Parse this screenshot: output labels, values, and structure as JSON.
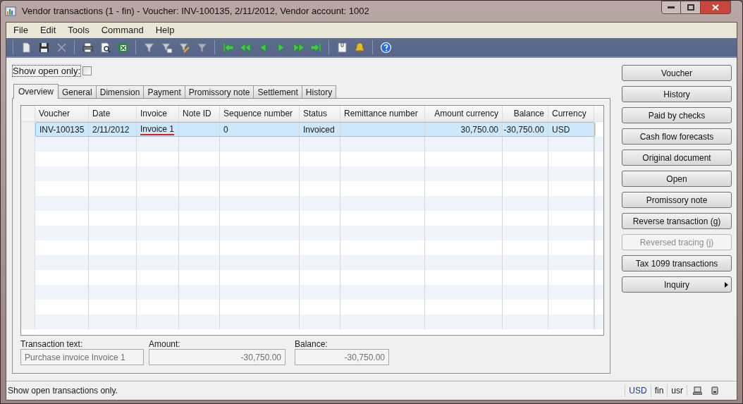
{
  "window": {
    "title": "Vendor transactions (1 - fin) - Voucher: INV-100135, 2/11/2012, Vendor account: 1002"
  },
  "menu": [
    "File",
    "Edit",
    "Tools",
    "Command",
    "Help"
  ],
  "show_open_only": {
    "label": "Show open only:",
    "checked": false
  },
  "tabs": [
    {
      "label": "Overview",
      "selected": true
    },
    {
      "label": "General",
      "selected": false
    },
    {
      "label": "Dimension",
      "selected": false
    },
    {
      "label": "Payment",
      "selected": false
    },
    {
      "label": "Promissory note",
      "selected": false
    },
    {
      "label": "Settlement",
      "selected": false
    },
    {
      "label": "History",
      "selected": false
    }
  ],
  "table": {
    "columns": [
      "Voucher",
      "Date",
      "Invoice",
      "Note ID",
      "Sequence number",
      "Status",
      "Remittance number",
      "Amount currency",
      "Balance",
      "Currency"
    ],
    "rows": [
      {
        "cells": [
          "INV-100135",
          "2/11/2012",
          "Invoice 1",
          "",
          "0",
          "Invoiced",
          "",
          "30,750.00",
          "-30,750.00",
          "USD"
        ],
        "selected": true,
        "invoice_underlined": true
      }
    ]
  },
  "fields": [
    {
      "label": "Transaction text:",
      "value": "Purchase invoice Invoice 1"
    },
    {
      "label": "Amount:",
      "value": "-30,750.00"
    },
    {
      "label": "Balance:",
      "value": "-30,750.00"
    }
  ],
  "buttons": [
    {
      "label": "Voucher",
      "disabled": false,
      "submenu": false
    },
    {
      "label": "History",
      "disabled": false,
      "submenu": false
    },
    {
      "label": "Paid by checks",
      "disabled": false,
      "submenu": false
    },
    {
      "label": "Cash flow forecasts",
      "disabled": false,
      "submenu": false
    },
    {
      "label": "Original document",
      "disabled": false,
      "submenu": false
    },
    {
      "label": "Open",
      "disabled": false,
      "submenu": false
    },
    {
      "label": "Promissory note",
      "disabled": false,
      "submenu": false
    },
    {
      "label": "Reverse transaction (g)",
      "disabled": false,
      "submenu": false
    },
    {
      "label": "Reversed tracing (j)",
      "disabled": true,
      "submenu": false
    },
    {
      "label": "Tax 1099 transactions",
      "disabled": false,
      "submenu": false
    },
    {
      "label": "Inquiry",
      "disabled": false,
      "submenu": true
    }
  ],
  "status_bar": {
    "text": "Show open transactions only.",
    "currency": "USD",
    "company": "fin",
    "layer": "usr"
  }
}
